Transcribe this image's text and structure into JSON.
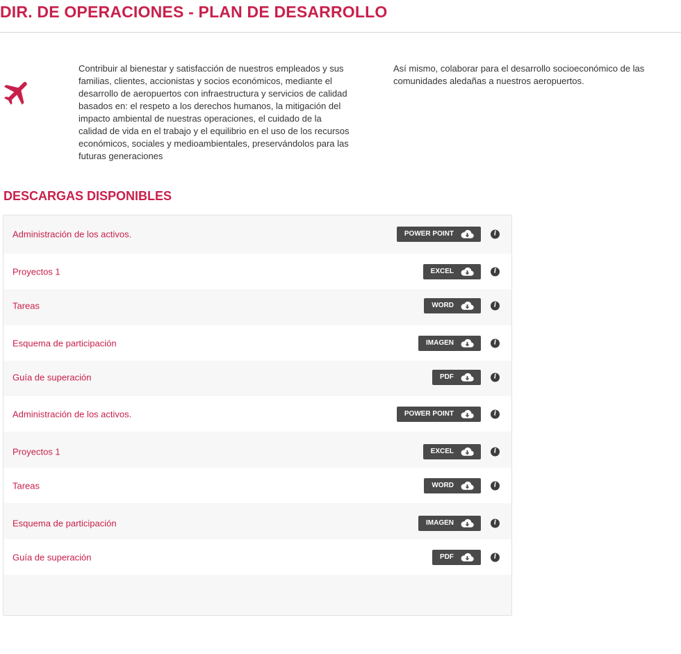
{
  "page": {
    "title": "DIR. DE OPERACIONES - PLAN DE DESARROLLO",
    "accent_color": "#c8204b",
    "icon": "airplane-icon"
  },
  "intro": {
    "col1": "Contribuir al bienestar y satisfacción de nuestros empleados y sus familias, clientes, accionistas y socios económicos, mediante el desarrollo de aeropuertos con infraestructura y servicios de calidad basados en: el respeto a los derechos humanos, la mitigación del impacto ambiental de nuestras operaciones, el cuidado de la calidad de vida en el trabajo y el equilibrio en el uso de los recursos económicos, sociales y medioambientales, preservándolos para las futuras generaciones",
    "col2": "Así mismo, colaborar para el desarrollo socioeconómico de las comunidades aledañas a nuestros aeropuertos."
  },
  "downloads": {
    "title": "DESCARGAS DISPONIBLES",
    "button_color": "#4a4a4a",
    "items": [
      {
        "name": "Administración de los activos.",
        "type": "POWER POINT"
      },
      {
        "name": "Proyectos 1",
        "type": "EXCEL"
      },
      {
        "name": "Tareas",
        "type": "WORD"
      },
      {
        "name": "Esquema de participación",
        "type": "IMAGEN"
      },
      {
        "name": "Guía de superación",
        "type": "PDF"
      },
      {
        "name": "Administración de los activos.",
        "type": "POWER POINT"
      },
      {
        "name": "Proyectos 1",
        "type": "EXCEL"
      },
      {
        "name": "Tareas",
        "type": "WORD"
      },
      {
        "name": "Esquema de participación",
        "type": "IMAGEN"
      },
      {
        "name": "Guía de superación",
        "type": "PDF"
      }
    ],
    "info_glyph": "i"
  }
}
